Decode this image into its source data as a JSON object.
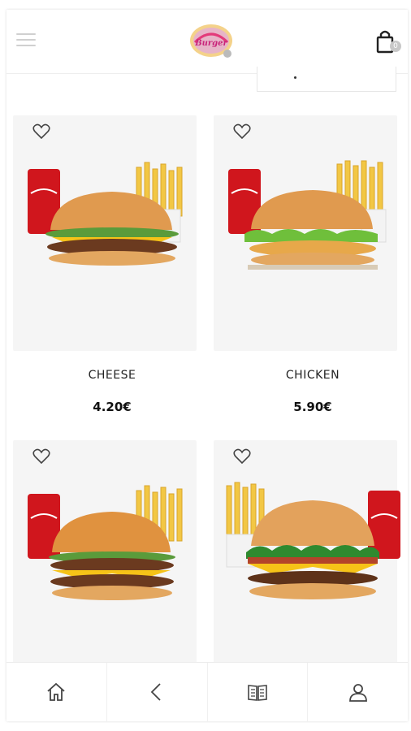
{
  "header": {
    "menu_icon": "hamburger-menu-icon",
    "logo_icon": "restaurant-logo-icon",
    "cart_icon": "shopping-bag-icon",
    "cart_count": "0"
  },
  "products": [
    {
      "name": "CHEESE",
      "price": "4.20€"
    },
    {
      "name": "CHICKEN",
      "price": "5.90€"
    },
    {
      "name": "",
      "price": ""
    },
    {
      "name": "",
      "price": ""
    }
  ],
  "bottom_nav": [
    {
      "icon": "home-icon"
    },
    {
      "icon": "back-chevron-icon"
    },
    {
      "icon": "menu-book-icon"
    },
    {
      "icon": "user-icon"
    }
  ],
  "colors": {
    "accent": "#d4372c",
    "text": "#222222"
  }
}
